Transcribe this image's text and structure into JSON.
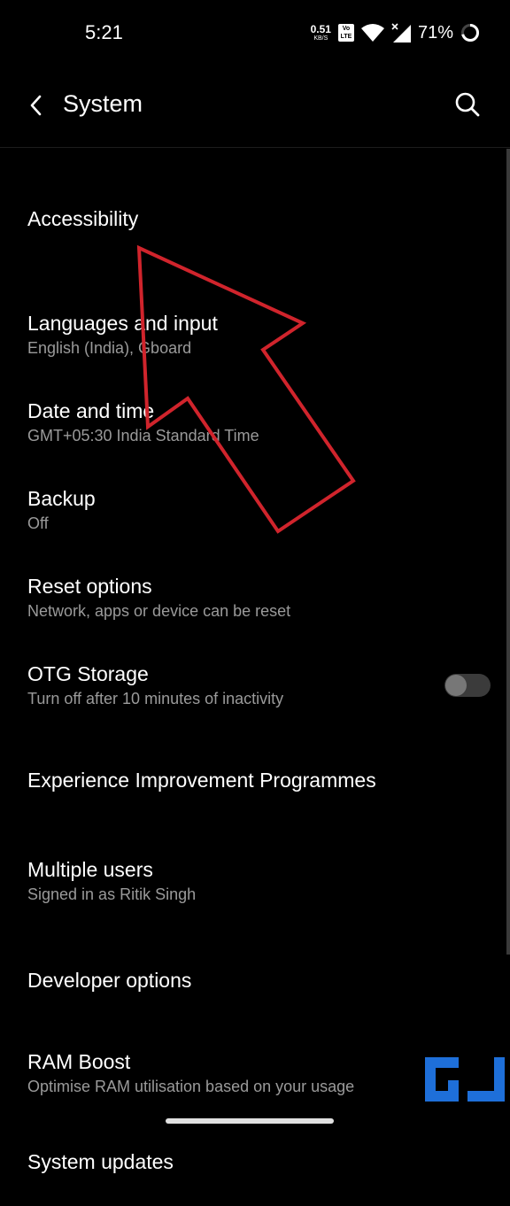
{
  "status_bar": {
    "time": "5:21",
    "net_speed_value": "0.51",
    "net_speed_unit": "KB/S",
    "volte_line1": "Vo",
    "volte_line2": "LTE",
    "battery_percent": "71%",
    "icons": [
      "wifi-icon",
      "signal-icon",
      "battery-ring-icon"
    ]
  },
  "app_bar": {
    "title": "System",
    "back_icon": "chevron-left-icon",
    "search_icon": "search-icon"
  },
  "items": [
    {
      "title": "Accessibility",
      "summary": ""
    },
    {
      "title": "Languages and input",
      "summary": "English (India), Gboard"
    },
    {
      "title": "Date and time",
      "summary": "GMT+05:30 India Standard Time"
    },
    {
      "title": "Backup",
      "summary": "Off"
    },
    {
      "title": "Reset options",
      "summary": "Network, apps or device can be reset"
    },
    {
      "title": "OTG Storage",
      "summary": "Turn off after 10 minutes of inactivity",
      "toggle_on": false
    },
    {
      "title": "Experience Improvement Programmes",
      "summary": ""
    },
    {
      "title": "Multiple users",
      "summary": "Signed in as Ritik Singh"
    },
    {
      "title": "Developer options",
      "summary": ""
    },
    {
      "title": "RAM Boost",
      "summary": "Optimise RAM utilisation based on your usage"
    },
    {
      "title": "System updates",
      "summary": ""
    }
  ],
  "colors": {
    "background": "#000000",
    "text_primary": "#ffffff",
    "text_secondary": "#9a9a9a",
    "annotation": "#d0242c",
    "watermark": "#1e6fd9"
  }
}
